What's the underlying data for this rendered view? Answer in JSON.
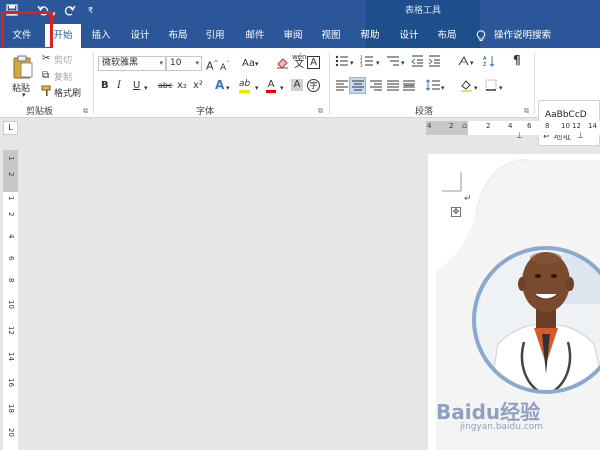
{
  "quick_access": {
    "save_icon": "save-icon",
    "undo_icon": "undo-icon",
    "redo_icon": "redo-icon",
    "customize": "₹"
  },
  "context_title": "表格工具",
  "tabs": [
    {
      "label": "文件"
    },
    {
      "label": "开始"
    },
    {
      "label": "插入"
    },
    {
      "label": "设计"
    },
    {
      "label": "布局"
    },
    {
      "label": "引用"
    },
    {
      "label": "邮件"
    },
    {
      "label": "审阅"
    },
    {
      "label": "视图"
    },
    {
      "label": "帮助"
    },
    {
      "label": "设计"
    },
    {
      "label": "布局"
    }
  ],
  "tell_me": "操作说明搜索",
  "clipboard": {
    "paste": "粘贴",
    "cut": "剪切",
    "copy": "复制",
    "format_painter": "格式刷",
    "group": "剪贴板"
  },
  "font": {
    "name": "微软雅黑",
    "size": "10",
    "grow": "A",
    "shrink": "A",
    "change_case": "Aa",
    "phonetic_top": "wén",
    "phonetic_bottom": "文",
    "border_char": "A",
    "bold": "B",
    "italic": "I",
    "underline": "U",
    "strike": "abc",
    "sub": "x₂",
    "sup": "x²",
    "text_effect": "A",
    "highlight": "ab",
    "font_color": "A",
    "char_shade": "A",
    "enclose": "字",
    "group": "字体"
  },
  "paragraph": {
    "group": "段落"
  },
  "styles": {
    "preview": "AaBbCcD",
    "item": "↵ 地址"
  },
  "hruler_ticks": [
    "4",
    "2",
    "2",
    "4",
    "6",
    "8",
    "10",
    "12",
    "14"
  ],
  "vruler_ticks": [
    "1",
    "2",
    "1",
    "2",
    "4",
    "6",
    "8",
    "10",
    "12",
    "14",
    "16",
    "18",
    "20"
  ],
  "colors": {
    "brand": "#2b579a",
    "highlight_box": "#e0211b",
    "photo_ring": "#8aa9cd"
  },
  "watermark": {
    "logo": "Baidu经验",
    "url": "jingyan.baidu.com"
  }
}
